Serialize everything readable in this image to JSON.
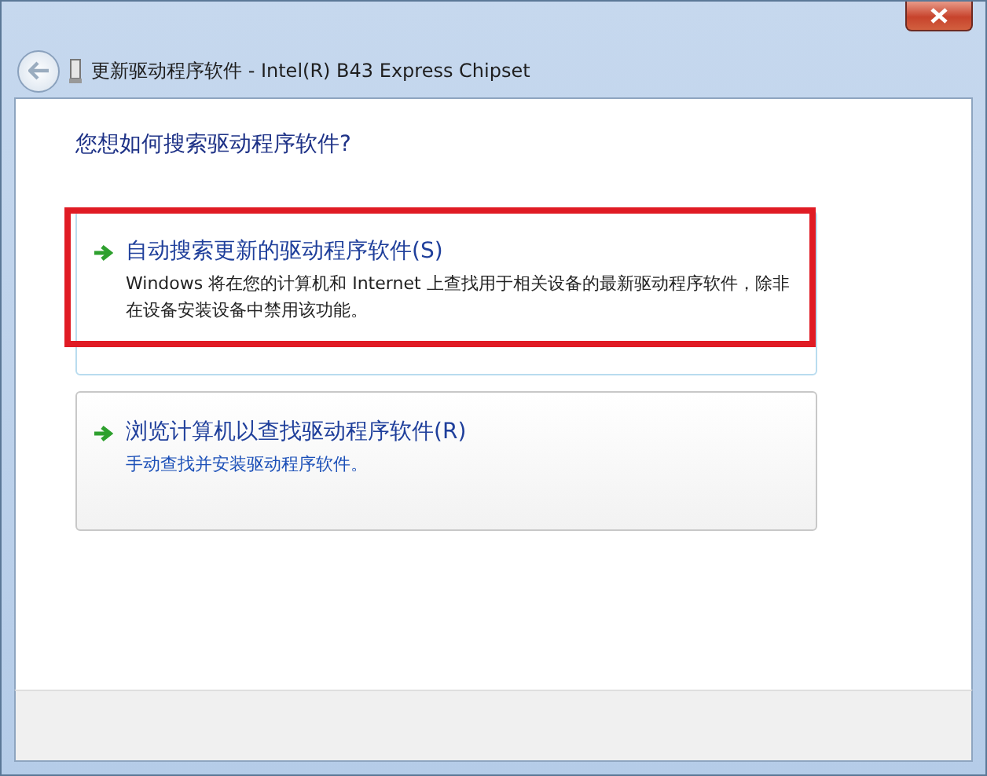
{
  "window": {
    "title": "更新驱动程序软件 - Intel(R) B43 Express Chipset"
  },
  "heading": "您想如何搜索驱动程序软件?",
  "options": [
    {
      "title": "自动搜索更新的驱动程序软件(S)",
      "description": "Windows 将在您的计算机和 Internet 上查找用于相关设备的最新驱动程序软件，除非在设备安装设备中禁用该功能。",
      "hovered": true,
      "annotated": true
    },
    {
      "title": "浏览计算机以查找驱动程序软件(R)",
      "description": "手动查找并安装驱动程序软件。",
      "hovered": false,
      "annotated": false
    }
  ]
}
